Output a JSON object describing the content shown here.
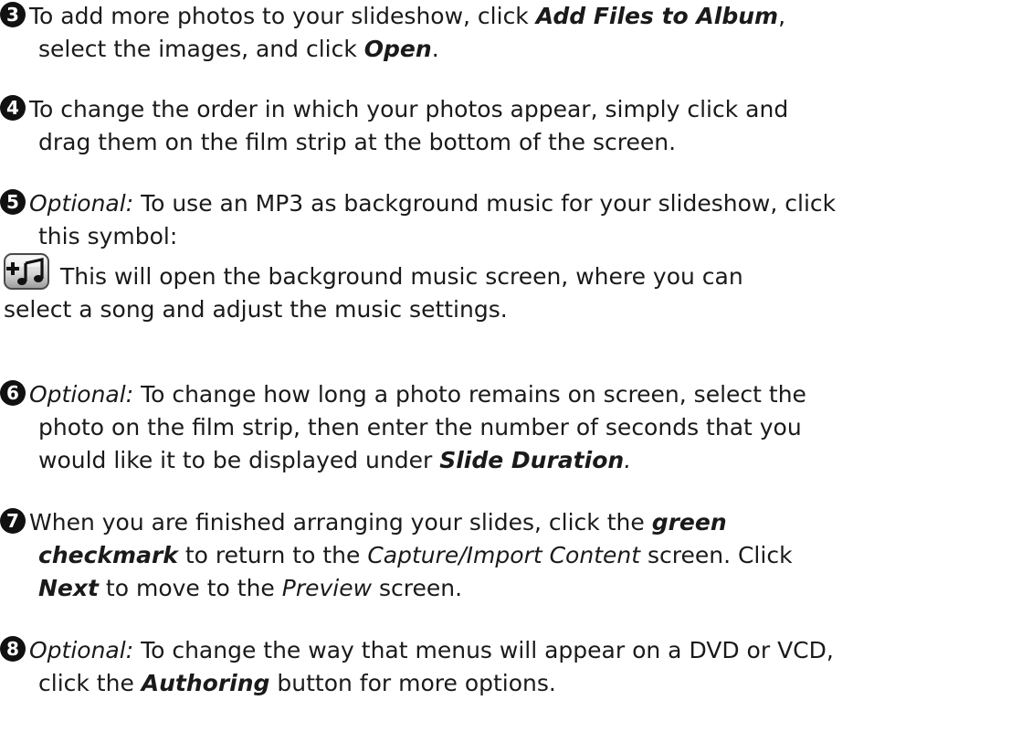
{
  "steps": [
    {
      "number": "3",
      "lines": [
        [
          "To add more photos to your slideshow, click ",
          "Add Files to Album",
          ","
        ],
        [
          "select the images, and click ",
          "Open",
          "."
        ]
      ]
    },
    {
      "number": "4",
      "lines": [
        "To change the order in which your photos appear, simply click and",
        "drag them on the film strip at the bottom of the screen."
      ]
    },
    {
      "number": "5",
      "optional_label": "Optional:",
      "lines": [
        " To use an MP3 as background music for your slideshow, click",
        "this symbol:",
        " This will open the background music screen, where you can",
        "select a song and adjust the music settings."
      ],
      "icon": "add-music-icon"
    },
    {
      "number": "6",
      "optional_label": "Optional:",
      "lines": [
        " To change how long a photo remains on screen, select the",
        "photo on the film strip, then enter the number of seconds that you",
        "would like it to be displayed under ",
        "Slide Duration",
        "."
      ]
    },
    {
      "number": "7",
      "lines": [
        "When you are finished arranging your slides, click the ",
        "green",
        "checkmark",
        " to return to the ",
        "Capture/Import Content",
        " screen. Click",
        "Next",
        " to move to the ",
        "Preview",
        " screen."
      ]
    },
    {
      "number": "8",
      "optional_label": "Optional:",
      "lines": [
        " To change the way that menus will appear on a DVD or VCD,",
        "click the ",
        "Authoring",
        " button for more options."
      ]
    }
  ]
}
